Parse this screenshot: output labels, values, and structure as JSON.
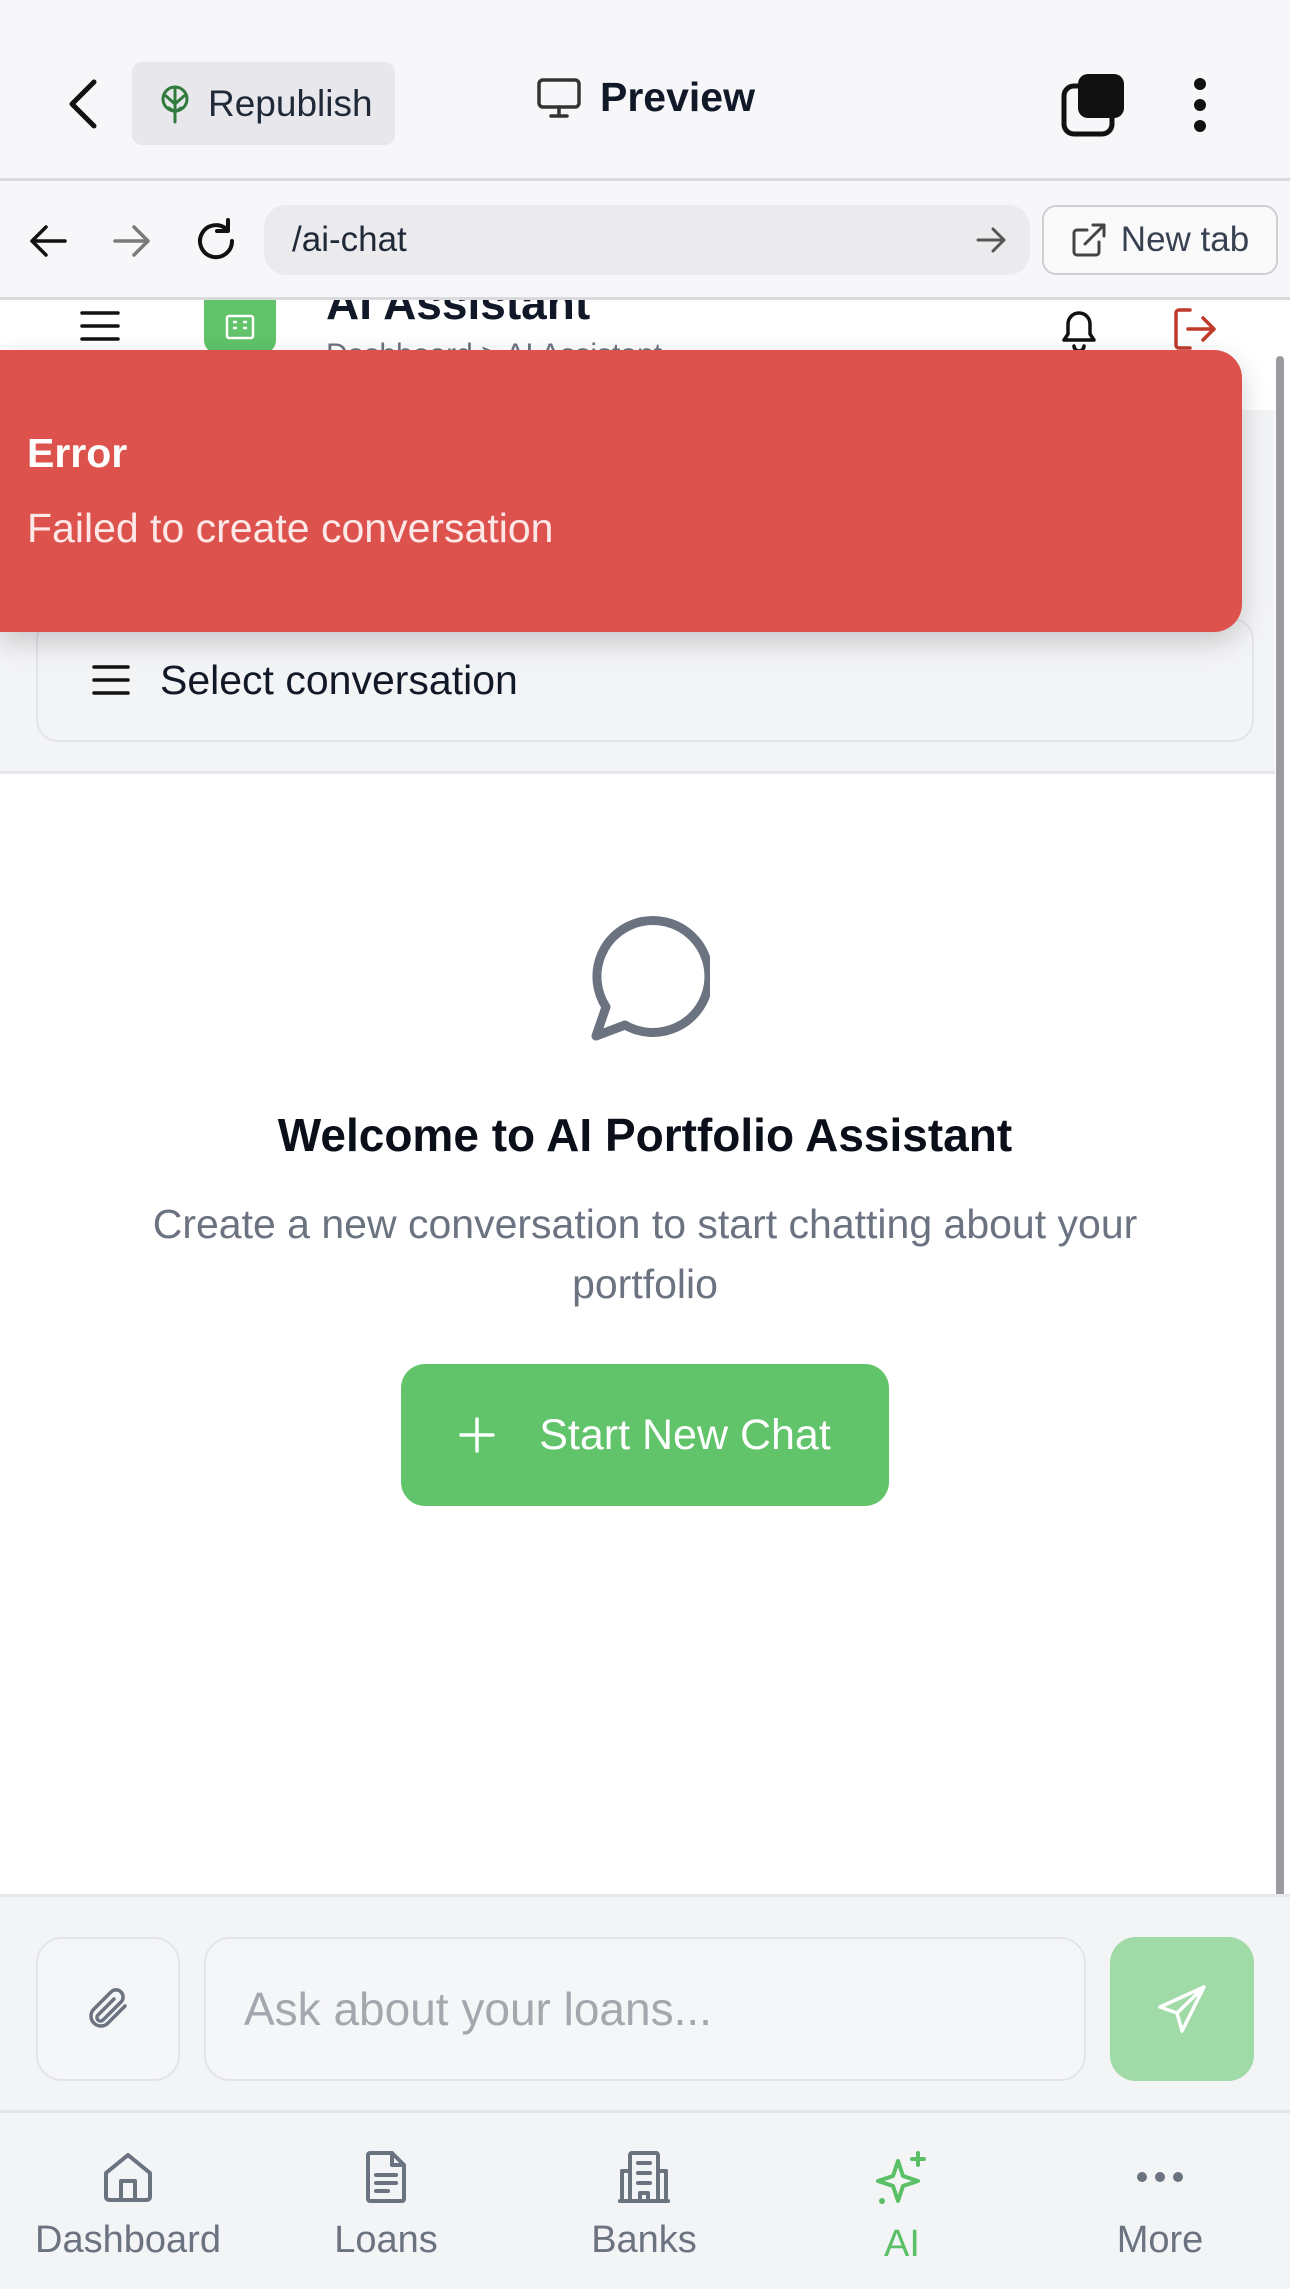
{
  "topbar": {
    "republish_label": "Republish",
    "preview_label": "Preview"
  },
  "browser": {
    "url": "/ai-chat",
    "new_tab_label": "New tab"
  },
  "app_header": {
    "title": "AI Assistant",
    "subtitle": "Dashboard > AI Assistant"
  },
  "toast": {
    "title": "Error",
    "message": "Failed to create conversation"
  },
  "conversation": {
    "select_label": "Select conversation"
  },
  "empty_state": {
    "title": "Welcome to AI Portfolio Assistant",
    "subtitle": "Create a new conversation to start chatting about your portfolio",
    "button_label": "Start New Chat"
  },
  "composer": {
    "placeholder": "Ask about your loans..."
  },
  "bottom_nav": {
    "items": [
      {
        "label": "Dashboard",
        "icon": "home-icon",
        "active": false
      },
      {
        "label": "Loans",
        "icon": "document-icon",
        "active": false
      },
      {
        "label": "Banks",
        "icon": "building-icon",
        "active": false
      },
      {
        "label": "AI",
        "icon": "sparkles-icon",
        "active": true
      },
      {
        "label": "More",
        "icon": "more-dots-icon",
        "active": false
      }
    ]
  },
  "colors": {
    "accent_green": "#61c36a",
    "error_red": "#dd524d",
    "send_disabled": "#9fdaa7",
    "logout_red": "#c0392b"
  }
}
